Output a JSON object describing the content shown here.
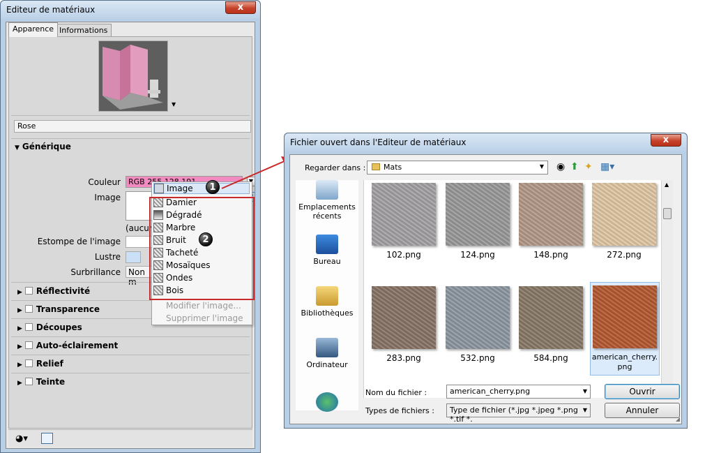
{
  "editor": {
    "title": "Editeur de matériaux",
    "tabs": [
      "Apparence",
      "Informations"
    ],
    "material_name": "Rose",
    "section_generic": "Générique",
    "labels": {
      "color": "Couleur",
      "image": "Image",
      "blur": "Estompe de l'image",
      "gloss": "Lustre",
      "highlight": "Surbrillance"
    },
    "color_value": "RGB 255 128 191",
    "image_none": "(aucun",
    "highlight_value": "Non m",
    "sections": [
      "Réflectivité",
      "Transparence",
      "Découpes",
      "Auto-éclairement",
      "Relief",
      "Teinte"
    ],
    "menu": {
      "top_item": "Image",
      "items": [
        "Damier",
        "Dégradé",
        "Marbre",
        "Bruit",
        "Tacheté",
        "Mosaïques",
        "Ondes",
        "Bois"
      ],
      "disabled": [
        "Modifier l'image...",
        "Supprimer l'image"
      ]
    },
    "badges": [
      "1",
      "2"
    ],
    "colors": {
      "pink": "#f18bc0",
      "accent_red": "#c8292a"
    }
  },
  "dialog": {
    "title": "Fichier ouvert dans l'Editeur de matériaux",
    "look_in_label": "Regarder dans :",
    "look_in_value": "Mats",
    "places": [
      "Emplacements récents",
      "Bureau",
      "Bibliothèques",
      "Ordinateur"
    ],
    "files": [
      {
        "name": "102.png",
        "color": "#a5a3a5"
      },
      {
        "name": "124.png",
        "color": "#9a9b9a"
      },
      {
        "name": "148.png",
        "color": "#b49a8a"
      },
      {
        "name": "272.png",
        "color": "#e1c8a5"
      },
      {
        "name": "283.png",
        "color": "#8a7568"
      },
      {
        "name": "532.png",
        "color": "#8f98a3"
      },
      {
        "name": "584.png",
        "color": "#8a7a68"
      },
      {
        "name": "american_cherry.png",
        "color": "#b65a32"
      }
    ],
    "filename_label": "Nom du fichier :",
    "filename_value": "american_cherry.png",
    "filetype_label": "Types de fichiers :",
    "filetype_value": "Type de fichier (*.jpg *.jpeg *.png *.tif *.",
    "open_button": "Ouvrir",
    "cancel_button": "Annuler",
    "close_glyph": "x"
  }
}
